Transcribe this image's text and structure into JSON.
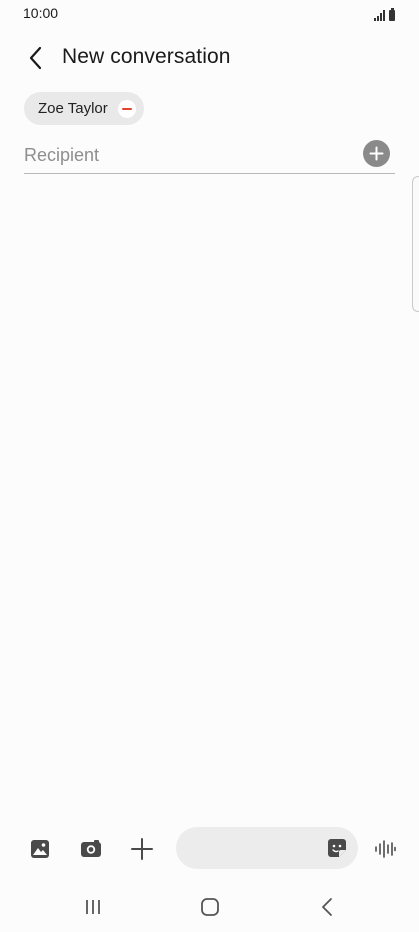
{
  "status_bar": {
    "time": "10:00",
    "icons": [
      "signal-icon",
      "battery-icon"
    ]
  },
  "header": {
    "title": "New conversation",
    "back_icon": "chevron-left-icon"
  },
  "recipients": {
    "chips": [
      {
        "label": "Zoe Taylor",
        "remove_icon": "minus-circle-icon"
      }
    ],
    "input": {
      "value": "",
      "placeholder": "Recipient"
    },
    "add_icon": "plus-circle-icon"
  },
  "composer": {
    "buttons": [
      "gallery-icon",
      "camera-icon",
      "plus-icon"
    ],
    "message": {
      "value": "",
      "placeholder": ""
    },
    "sticker_icon": "sticker-icon",
    "voice_icon": "voice-wave-icon"
  },
  "nav_bar": {
    "buttons": [
      "recents-icon",
      "home-icon",
      "back-icon"
    ]
  },
  "colors": {
    "background": "#fcfcfc",
    "chip_background": "#e9e9e9",
    "remove_accent": "#e0432f",
    "add_button": "#8a8a8a",
    "divider": "#b8b8b8",
    "icon": "#4a4a4a"
  }
}
